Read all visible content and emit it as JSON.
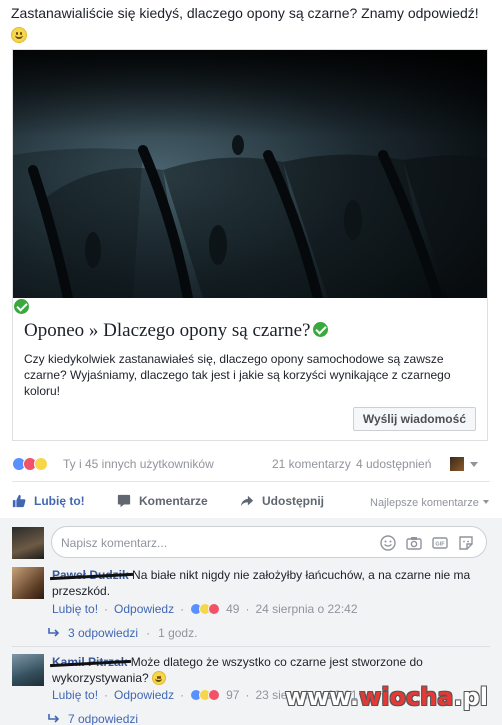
{
  "post": {
    "text": "Zastanawialiście się kiedyś, dlaczego opony są czarne? Znamy odpowiedź!",
    "emoji": "smile-emoji"
  },
  "link_card": {
    "title": "Oponeo » Dlaczego opony są czarne?",
    "description": "Czy kiedykolwiek zastanawiałeś się, dlaczego opony samochodowe są zawsze czarne? Wyjaśniamy, dlaczego tak jest i jakie są korzyści wynikające z czarnego koloru!",
    "send_button": "Wyślij wiadomość",
    "verified_color": "#3aa83f"
  },
  "reactions": {
    "text": "Ty i 45 innych użytkowników",
    "comments": "21 komentarzy",
    "shares": "4 udostępnień",
    "colors": {
      "like": "#5890ff",
      "love": "#f25268",
      "haha": "#f7d74a"
    }
  },
  "actions": {
    "like": "Lubię to!",
    "comment": "Komentarze",
    "share": "Udostępnij",
    "sort": "Najlepsze komentarze",
    "accent": "#4267b2"
  },
  "composer": {
    "placeholder": "Napisz komentarz..."
  },
  "comments": [
    {
      "author": "Paweł Dudzik",
      "text": "Na białe nikt nigdy nie założyłby łańcuchów, a na czarne nie ma przeszkód.",
      "like": "Lubię to!",
      "reply": "Odpowiedz",
      "reaction_count": "49",
      "date": "24 sierpnia o 22:42",
      "replies": "3 odpowiedzi",
      "replies_time": "1 godz."
    },
    {
      "author": "Kamil Pitrzak",
      "text": "Może dlatego że wszystko co czarne jest stworzone do wykorzystywania?",
      "like": "Lubię to!",
      "reply": "Odpowiedz",
      "reaction_count": "97",
      "date": "23 sierpnia o 20:01",
      "replies": "7 odpowiedzi"
    }
  ],
  "watermark": {
    "prefix": "www.",
    "name": "wiocha",
    "suffix": ".pl"
  }
}
